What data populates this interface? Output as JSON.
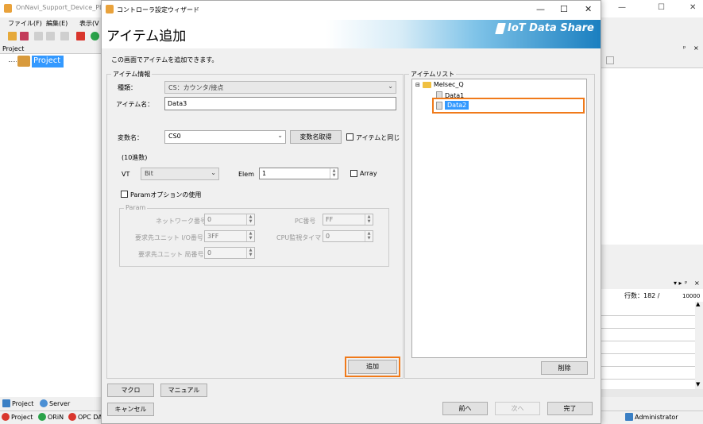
{
  "background_app": {
    "title": "OnNavi_Support_Device_PLC",
    "menu": [
      "ファイル(F)",
      "編集(E)",
      "表示(V"
    ],
    "project_pane_label": "Project",
    "tree_root": "Project",
    "bottom_tabs": [
      "Project",
      "Server"
    ],
    "status_items": [
      "Project",
      "ORiN",
      "OPC DA"
    ],
    "status_user": "Administrator",
    "row_count_label": "行数：182 /",
    "row_total": "10000",
    "pin_glyph": "ᵖ",
    "close_glyph": "×",
    "arrows_glyph": "▾ ▸"
  },
  "dialog": {
    "title": "コントローラ設定ウィザード",
    "heading": "アイテム追加",
    "brand": "IoT Data Share",
    "description": "この画面でアイテムを追加できます。",
    "item_info": {
      "group_label": "アイテム情報",
      "type_label": "種類：",
      "type_value": "CS：カウンタ/接点",
      "name_label": "アイテム名：",
      "name_value": "Data3",
      "var_label": "変数名：",
      "var_value": "CS0",
      "fetch_var_button": "変数名取得",
      "same_as_item_label": "アイテムと同じ",
      "radix_label": "(10進数)",
      "vt_label": "VT",
      "vt_value": "Bit",
      "elem_label": "Elem",
      "elem_value": "1",
      "array_label": "Array",
      "param_option_label": "Paramオプションの使用",
      "param": {
        "group_label": "Param",
        "network_no_label": "ネットワーク番号",
        "network_no_value": "0",
        "pc_no_label": "PC番号",
        "pc_no_value": "FF",
        "req_unit_io_label": "要求先ユニット I/O番号",
        "req_unit_io_value": "3FF",
        "cpu_timer_label": "CPU監視タイマ",
        "cpu_timer_value": "0",
        "req_unit_station_label": "要求先ユニット 局番号",
        "req_unit_station_value": "0"
      },
      "add_button": "追加"
    },
    "item_list": {
      "group_label": "アイテムリスト",
      "tree": [
        {
          "label": "Melsec_Q",
          "children": [
            "Data1",
            "Data2"
          ]
        }
      ],
      "selected": "Data2",
      "delete_button": "削除"
    },
    "macro_button": "マクロ",
    "manual_button": "マニュアル",
    "cancel_button": "キャンセル",
    "prev_button": "前へ",
    "next_button": "次へ",
    "finish_button": "完了"
  },
  "colors": {
    "highlight": "#f07a1a",
    "selection": "#3399ff",
    "banner_blue": "#1a7fc0"
  }
}
